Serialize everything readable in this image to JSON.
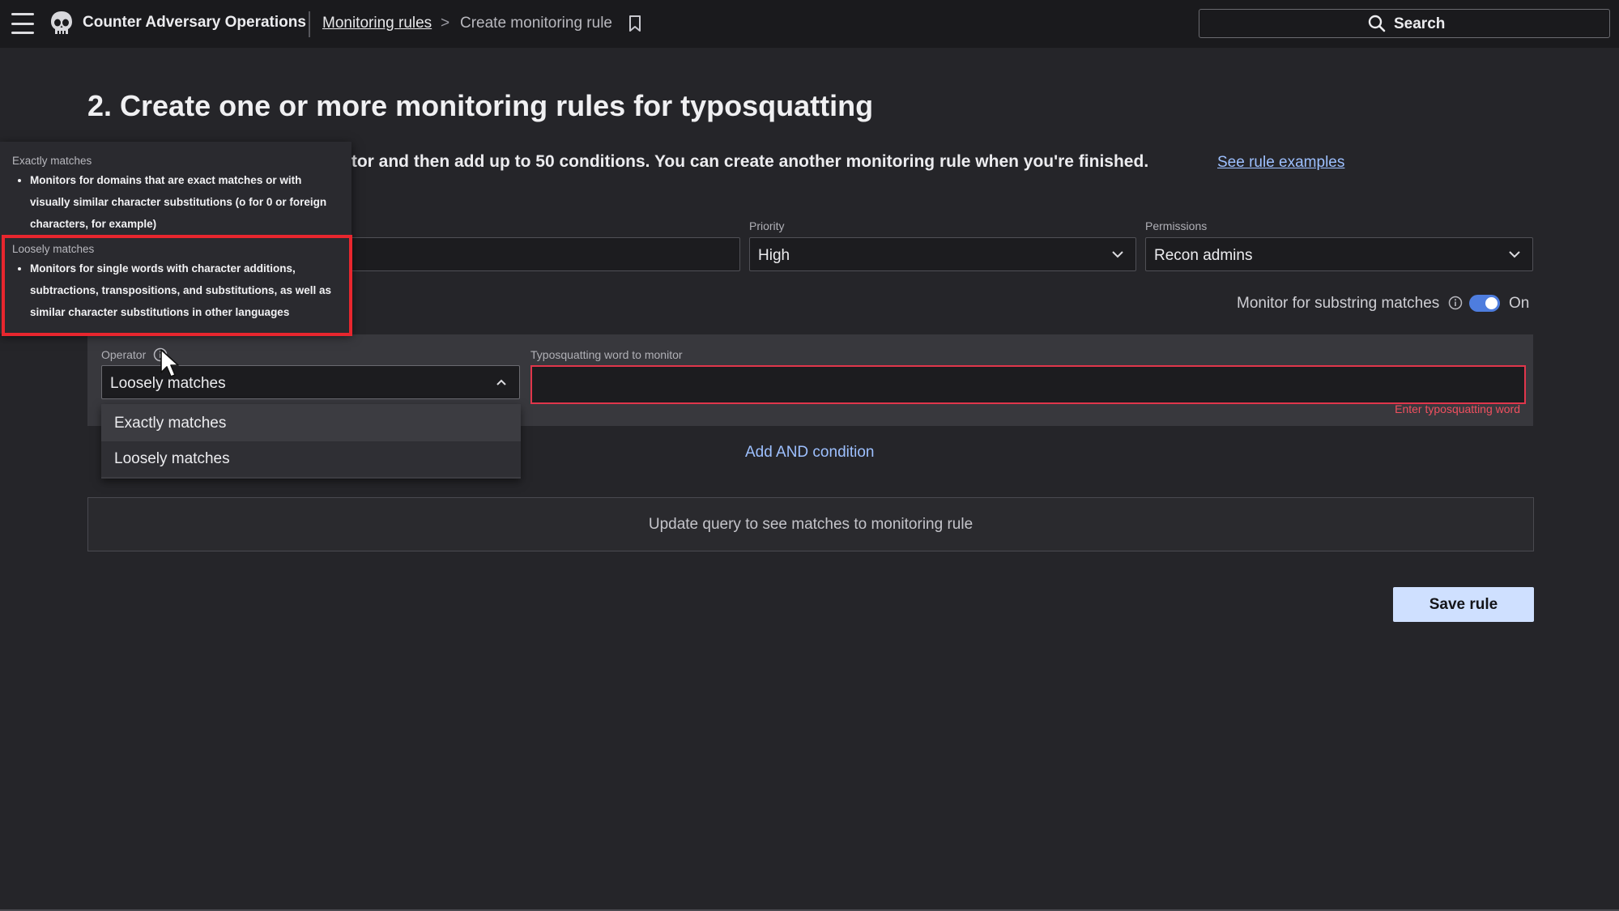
{
  "app": {
    "title": "Counter Adversary Operations",
    "breadcrumb": {
      "parent": "Monitoring rules",
      "separator": ">",
      "current": "Create monitoring rule"
    },
    "search_label": "Search"
  },
  "page": {
    "title": "2. Create one or more monitoring rules for typosquatting",
    "description_visible": "itor and then add up to 50 conditions. You can create another monitoring rule when you're finished.",
    "see_examples_link": "See rule examples"
  },
  "form": {
    "priority": {
      "label": "Priority",
      "value": "High"
    },
    "permissions": {
      "label": "Permissions",
      "value": "Recon admins"
    },
    "substring": {
      "label": "Monitor for substring matches",
      "state": "On",
      "enabled": true,
      "accent": "#4e7dde"
    },
    "operator": {
      "label": "Operator",
      "value": "Loosely matches",
      "options": [
        "Exactly matches",
        "Loosely matches"
      ]
    },
    "typo_word": {
      "label": "Typosquatting word to monitor",
      "value": "",
      "error": "Enter typosquatting word",
      "error_color": "#e0364b"
    },
    "add_and_label": "Add AND condition",
    "preview_text": "Update query to see matches to monitoring rule",
    "save_label": "Save rule"
  },
  "tooltip": {
    "exact": {
      "heading": "Exactly matches",
      "text": "Monitors for domains that are exact matches or with visually similar character substitutions (o for 0 or foreign characters, for example)"
    },
    "loose": {
      "heading": "Loosely matches",
      "text": "Monitors for single words with character additions, subtractions, transpositions, and substitutions, as well as similar character substitutions in other languages"
    }
  },
  "icons": {
    "menu": "hamburger-icon",
    "logo": "skull-logo-icon",
    "bookmark": "bookmark-icon",
    "search": "search-icon",
    "chevron": "chevron-down-icon",
    "info": "info-icon",
    "cursor": "mouse-pointer-icon"
  }
}
